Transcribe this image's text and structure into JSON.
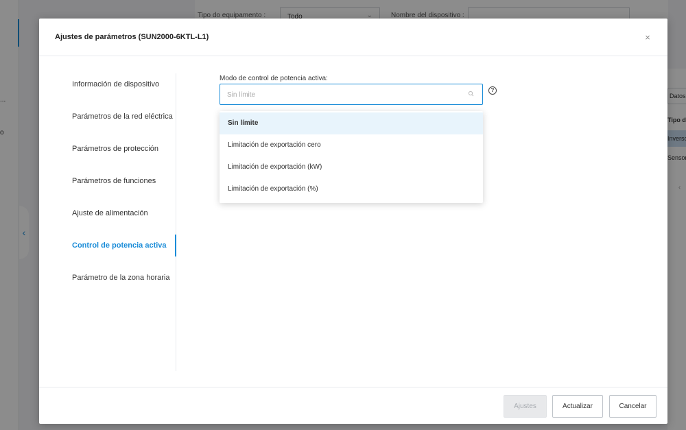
{
  "background": {
    "filter": {
      "equipment_type_label": "Tipo do equipamento :",
      "equipment_type_value": "Todo",
      "device_name_label": "Nombre del dispositivo :"
    },
    "sidebar_text_1": "...",
    "sidebar_text_2": "o",
    "right_panel": {
      "button_label": "Datos",
      "column_header": "Tipo de",
      "row_1": "Inversor",
      "row_2": "Sensor"
    }
  },
  "modal": {
    "title": "Ajustes de parámetros (SUN2000-6KTL-L1)",
    "close_symbol": "×",
    "nav": [
      {
        "label": "Información de dispositivo"
      },
      {
        "label": "Parámetros de la red eléctrica"
      },
      {
        "label": "Parámetros de protección"
      },
      {
        "label": "Parámetros de funciones"
      },
      {
        "label": "Ajuste de alimentación"
      },
      {
        "label": "Control de potencia activa"
      },
      {
        "label": "Parámetro de la zona horaria"
      }
    ],
    "active_nav_index": 5,
    "field": {
      "label": "Modo de control de potencia activa:",
      "placeholder": "Sin límite",
      "value": "",
      "help_symbol": "?"
    },
    "dropdown": {
      "options": [
        {
          "label": "Sin límite"
        },
        {
          "label": "Limitación de exportación cero"
        },
        {
          "label": "Limitación de exportación (kW)"
        },
        {
          "label": "Limitación de exportación (%)"
        }
      ],
      "selected_index": 0
    },
    "footer": {
      "ajustes_label": "Ajustes",
      "actualizar_label": "Actualizar",
      "cancelar_label": "Cancelar"
    }
  },
  "colors": {
    "accent": "#1a8cd8",
    "selected_option_bg": "#e8f4fc",
    "disabled_button_bg": "#e8e9eb"
  }
}
